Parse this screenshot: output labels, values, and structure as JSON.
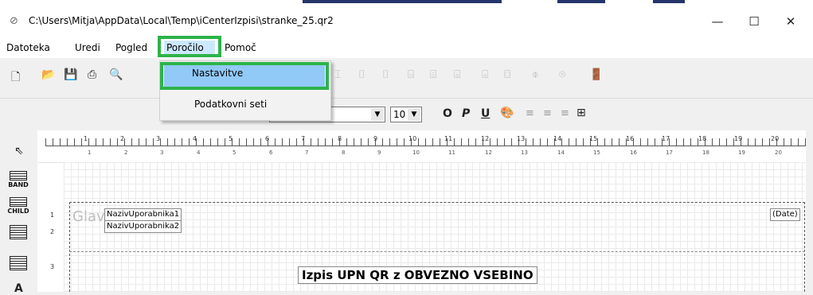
{
  "window": {
    "title": "C:\\Users\\Mitja\\AppData\\Local\\Temp\\iCenterIzpisi\\stranke_25.qr2",
    "minimize": "—",
    "maximize": "☐",
    "close": "✕"
  },
  "menubar": {
    "items": [
      "Datoteka",
      "Uredi",
      "Pogled",
      "Poročilo",
      "Pomoč"
    ]
  },
  "menu_dropdown": {
    "items": [
      "Nastavitve",
      "Podatkovni seti"
    ],
    "highlight_color": "#2db34a",
    "selected_color": "#91c9f7"
  },
  "format_toolbar": {
    "font_size": "10",
    "bold": "O",
    "italic": "P",
    "underline": "U"
  },
  "toolbox": {
    "band_label": "BAND",
    "child_label": "CHILD"
  },
  "ruler": {
    "numbers": [
      "1",
      "2",
      "3",
      "4",
      "5",
      "6",
      "7",
      "8",
      "9",
      "10",
      "11",
      "12",
      "13",
      "14",
      "15",
      "16",
      "17",
      "18",
      "19",
      "20"
    ]
  },
  "bands": {
    "numbers": [
      "1",
      "2",
      "3"
    ],
    "band_title": "Glav"
  },
  "report": {
    "field1": "NazivUporabnika1",
    "field2": "NazivUporabnika2",
    "date": "(Date)",
    "title": "Izpis UPN QR z OBVEZNO VSEBINO"
  }
}
